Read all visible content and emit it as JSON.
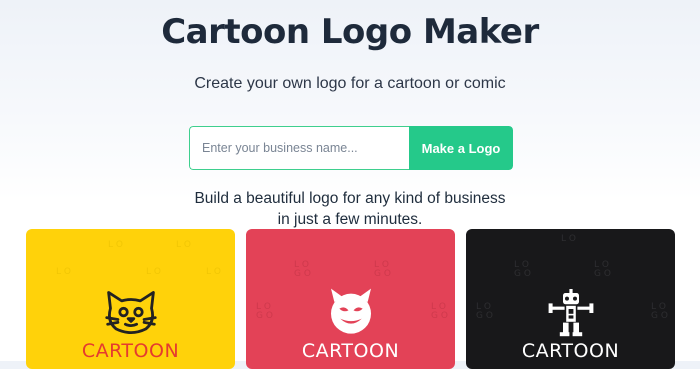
{
  "hero": {
    "title": "Cartoon Logo Maker",
    "subtitle": "Create your own logo for a cartoon or comic"
  },
  "search": {
    "placeholder": "Enter your business name...",
    "value": "",
    "button_label": "Make a Logo"
  },
  "tagline": {
    "line1": "Build a beautiful logo for any kind of business",
    "line2": "in just a few minutes."
  },
  "cards": [
    {
      "label": "CARTOON",
      "background": "#ffd20a",
      "text_color": "#e53b2f",
      "icon": "cat-face-icon"
    },
    {
      "label": "CARTOON",
      "background": "#e34257",
      "text_color": "#ffffff",
      "icon": "devil-face-icon"
    },
    {
      "label": "CARTOON",
      "background": "#18181a",
      "text_color": "#ffffff",
      "icon": "robot-icon"
    }
  ],
  "colors": {
    "accent": "#25c98a",
    "title": "#1e2a3b"
  }
}
